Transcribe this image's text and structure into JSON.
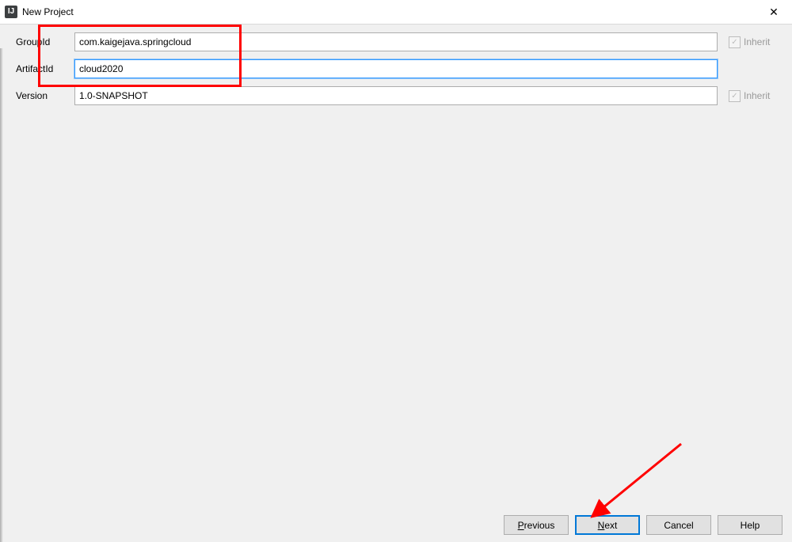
{
  "window": {
    "title": "New Project",
    "close": "✕"
  },
  "form": {
    "group_id_label": "GroupId",
    "group_id_value": "com.kaigejava.springcloud",
    "artifact_id_label": "ArtifactId",
    "artifact_id_value": "cloud2020",
    "version_label": "Version",
    "version_value": "1.0-SNAPSHOT",
    "inherit_label": "Inherit",
    "inherit_group_checked": true,
    "inherit_group_enabled": false,
    "inherit_version_checked": true,
    "inherit_version_enabled": false
  },
  "buttons": {
    "previous": "Previous",
    "next": "Next",
    "cancel": "Cancel",
    "help": "Help"
  },
  "annotations": {
    "arrow_color": "#ff0000",
    "highlight_color": "#ff0000"
  }
}
